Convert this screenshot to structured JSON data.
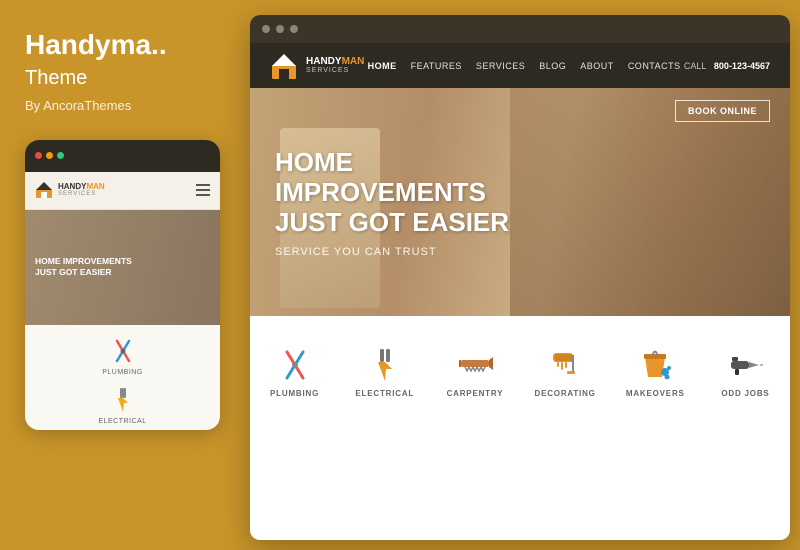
{
  "leftPanel": {
    "title": "Handyma..",
    "subtitle": "Theme",
    "author": "By AncoraThemes"
  },
  "mobileMockup": {
    "dots": [
      "#e74c3c",
      "#f39c12",
      "#2ecc71"
    ],
    "logo": {
      "brand": "HANDY",
      "brandHighlight": "MAN",
      "sub": "SERVICES"
    },
    "hero": {
      "line1": "HOME IMPROVEMENTS",
      "line2": "JUST GOT EASIER"
    },
    "services": [
      {
        "label": "PLUMBING",
        "icon": "plumbing"
      },
      {
        "label": "ELECTRICAL",
        "icon": "electrical"
      }
    ]
  },
  "desktopPreview": {
    "dots": [
      "dot",
      "dot",
      "dot"
    ],
    "nav": {
      "logo": {
        "brand": "HANDY",
        "brandHighlight": "MAN",
        "sub": "SERVICES"
      },
      "links": [
        "HOME",
        "FEATURES",
        "SERVICES",
        "BLOG",
        "ABOUT",
        "CONTACTS"
      ],
      "callLabel": "CALL",
      "callNumber": "800-123-4567"
    },
    "hero": {
      "bookBtn": "BOOK ONLINE",
      "title": "HOME IMPROVEMENTS\nJUST GOT EASIER",
      "subtitle": "SERVICE YOU CAN TRUST"
    },
    "services": [
      {
        "label": "PLUMBING",
        "icon": "plumbing"
      },
      {
        "label": "ELECTRICAL",
        "icon": "electrical"
      },
      {
        "label": "CARPENTRY",
        "icon": "carpentry"
      },
      {
        "label": "DECORATING",
        "icon": "decorating"
      },
      {
        "label": "MAKEOVERS",
        "icon": "makeovers"
      },
      {
        "label": "ODD JOBS",
        "icon": "odd-jobs"
      }
    ]
  }
}
